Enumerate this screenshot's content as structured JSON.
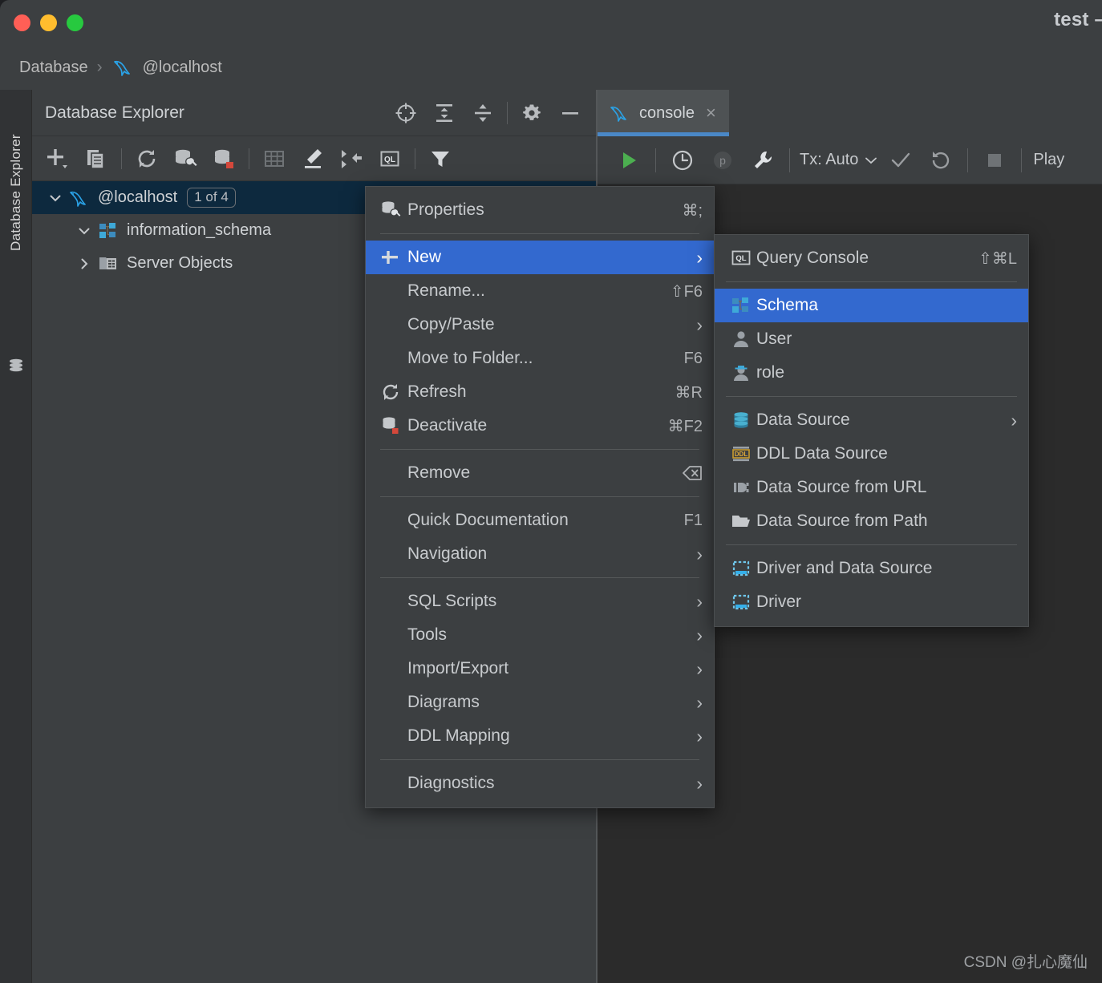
{
  "window": {
    "title": "test –",
    "traffic_lights": [
      "close-red",
      "minimize-yellow",
      "maximize-green"
    ],
    "colors": {
      "panel_bg": "#3c3f41",
      "editor_bg": "#2b2b2b",
      "strip_bg": "#313335",
      "selection_blue": "#3369cf",
      "tree_selection": "#0d293e",
      "tab_underline": "#4a88c7",
      "accent_cyan": "#3c9dd0",
      "red_marker": "#d4483b"
    }
  },
  "breadcrumb": {
    "items": [
      {
        "label": "Database",
        "icon": "none"
      },
      {
        "label": "@localhost",
        "icon": "mysql-dolphin-icon"
      }
    ],
    "separator": "›"
  },
  "left_strip": {
    "label": "Database Explorer",
    "icon": "database-stack-icon"
  },
  "explorer": {
    "title": "Database Explorer",
    "header_actions": [
      {
        "name": "scroll-from-source-icon"
      },
      {
        "name": "expand-all-icon"
      },
      {
        "name": "collapse-all-icon"
      },
      {
        "name": "settings-gear-icon"
      },
      {
        "name": "hide-panel-icon"
      }
    ],
    "toolbar_actions": [
      {
        "name": "add-new-icon"
      },
      {
        "name": "duplicate-icon"
      },
      {
        "name": "refresh-icon"
      },
      {
        "name": "data-source-properties-icon"
      },
      {
        "name": "deactivate-data-source-icon"
      },
      {
        "name": "table-editor-icon"
      },
      {
        "name": "modify-icon"
      },
      {
        "name": "jump-to-console-icon"
      },
      {
        "name": "query-console-icon"
      },
      {
        "name": "filter-icon"
      }
    ],
    "tree": [
      {
        "label": "@localhost",
        "badge": "1 of 4",
        "icon": "mysql-dolphin-icon",
        "expanded": true,
        "selected": true,
        "depth": 0
      },
      {
        "label": "information_schema",
        "badge": "",
        "icon": "schema-icon",
        "expanded": true,
        "selected": false,
        "depth": 1
      },
      {
        "label": "Server Objects",
        "badge": "",
        "icon": "server-objects-icon",
        "expanded": false,
        "selected": false,
        "depth": 1
      }
    ]
  },
  "editor": {
    "tab": {
      "label": "console",
      "icon": "mysql-dolphin-icon",
      "close": "×"
    },
    "toolbar": {
      "run_label": "",
      "tx_label": "Tx: Auto",
      "tx_chevron": "⌄",
      "play_label": "Play",
      "buttons": [
        {
          "name": "execute-run-icon"
        },
        {
          "name": "history-icon"
        },
        {
          "name": "parameters-icon"
        },
        {
          "name": "wrench-settings-icon"
        },
        {
          "name": "commit-icon"
        },
        {
          "name": "rollback-icon"
        },
        {
          "name": "stop-icon"
        }
      ]
    }
  },
  "context_menu": {
    "groups": [
      {
        "items": [
          {
            "label": "Properties",
            "shortcut": "⌘;",
            "icon": "properties-icon",
            "arrow": false,
            "selected": false
          }
        ]
      },
      {
        "items": [
          {
            "label": "New",
            "shortcut": "",
            "icon": "plus-icon",
            "arrow": true,
            "selected": true
          },
          {
            "label": "Rename...",
            "shortcut": "⇧F6",
            "icon": "",
            "arrow": false,
            "selected": false
          },
          {
            "label": "Copy/Paste",
            "shortcut": "",
            "icon": "",
            "arrow": true,
            "selected": false
          },
          {
            "label": "Move to Folder...",
            "shortcut": "F6",
            "icon": "",
            "arrow": false,
            "selected": false
          },
          {
            "label": "Refresh",
            "shortcut": "⌘R",
            "icon": "refresh-icon",
            "arrow": false,
            "selected": false
          },
          {
            "label": "Deactivate",
            "shortcut": "⌘F2",
            "icon": "deactivate-icon",
            "arrow": false,
            "selected": false
          }
        ]
      },
      {
        "items": [
          {
            "label": "Remove",
            "shortcut": "⌧",
            "icon": "",
            "arrow": false,
            "selected": false
          }
        ]
      },
      {
        "items": [
          {
            "label": "Quick Documentation",
            "shortcut": "F1",
            "icon": "",
            "arrow": false,
            "selected": false
          },
          {
            "label": "Navigation",
            "shortcut": "",
            "icon": "",
            "arrow": true,
            "selected": false
          }
        ]
      },
      {
        "items": [
          {
            "label": "SQL Scripts",
            "shortcut": "",
            "icon": "",
            "arrow": true,
            "selected": false
          },
          {
            "label": "Tools",
            "shortcut": "",
            "icon": "",
            "arrow": true,
            "selected": false
          },
          {
            "label": "Import/Export",
            "shortcut": "",
            "icon": "",
            "arrow": true,
            "selected": false
          },
          {
            "label": "Diagrams",
            "shortcut": "",
            "icon": "",
            "arrow": true,
            "selected": false
          },
          {
            "label": "DDL Mapping",
            "shortcut": "",
            "icon": "",
            "arrow": true,
            "selected": false
          }
        ]
      },
      {
        "items": [
          {
            "label": "Diagnostics",
            "shortcut": "",
            "icon": "",
            "arrow": true,
            "selected": false
          }
        ]
      }
    ]
  },
  "submenu": {
    "groups": [
      {
        "items": [
          {
            "label": "Query Console",
            "shortcut": "⇧⌘L",
            "icon": "query-console-icon",
            "arrow": false,
            "selected": false
          }
        ]
      },
      {
        "items": [
          {
            "label": "Schema",
            "shortcut": "",
            "icon": "schema-icon",
            "arrow": false,
            "selected": true
          },
          {
            "label": "User",
            "shortcut": "",
            "icon": "user-icon",
            "arrow": false,
            "selected": false
          },
          {
            "label": "role",
            "shortcut": "",
            "icon": "role-icon",
            "arrow": false,
            "selected": false
          }
        ]
      },
      {
        "items": [
          {
            "label": "Data Source",
            "shortcut": "",
            "icon": "data-source-icon",
            "arrow": true,
            "selected": false
          },
          {
            "label": "DDL Data Source",
            "shortcut": "",
            "icon": "ddl-data-source-icon",
            "arrow": false,
            "selected": false
          },
          {
            "label": "Data Source from URL",
            "shortcut": "",
            "icon": "data-source-url-icon",
            "arrow": false,
            "selected": false
          },
          {
            "label": "Data Source from Path",
            "shortcut": "",
            "icon": "folder-icon",
            "arrow": false,
            "selected": false
          }
        ]
      },
      {
        "items": [
          {
            "label": "Driver and Data Source",
            "shortcut": "",
            "icon": "driver-icon",
            "arrow": false,
            "selected": false
          },
          {
            "label": "Driver",
            "shortcut": "",
            "icon": "driver-icon",
            "arrow": false,
            "selected": false
          }
        ]
      }
    ]
  },
  "watermark": {
    "text": "CSDN @扎心魔仙"
  }
}
